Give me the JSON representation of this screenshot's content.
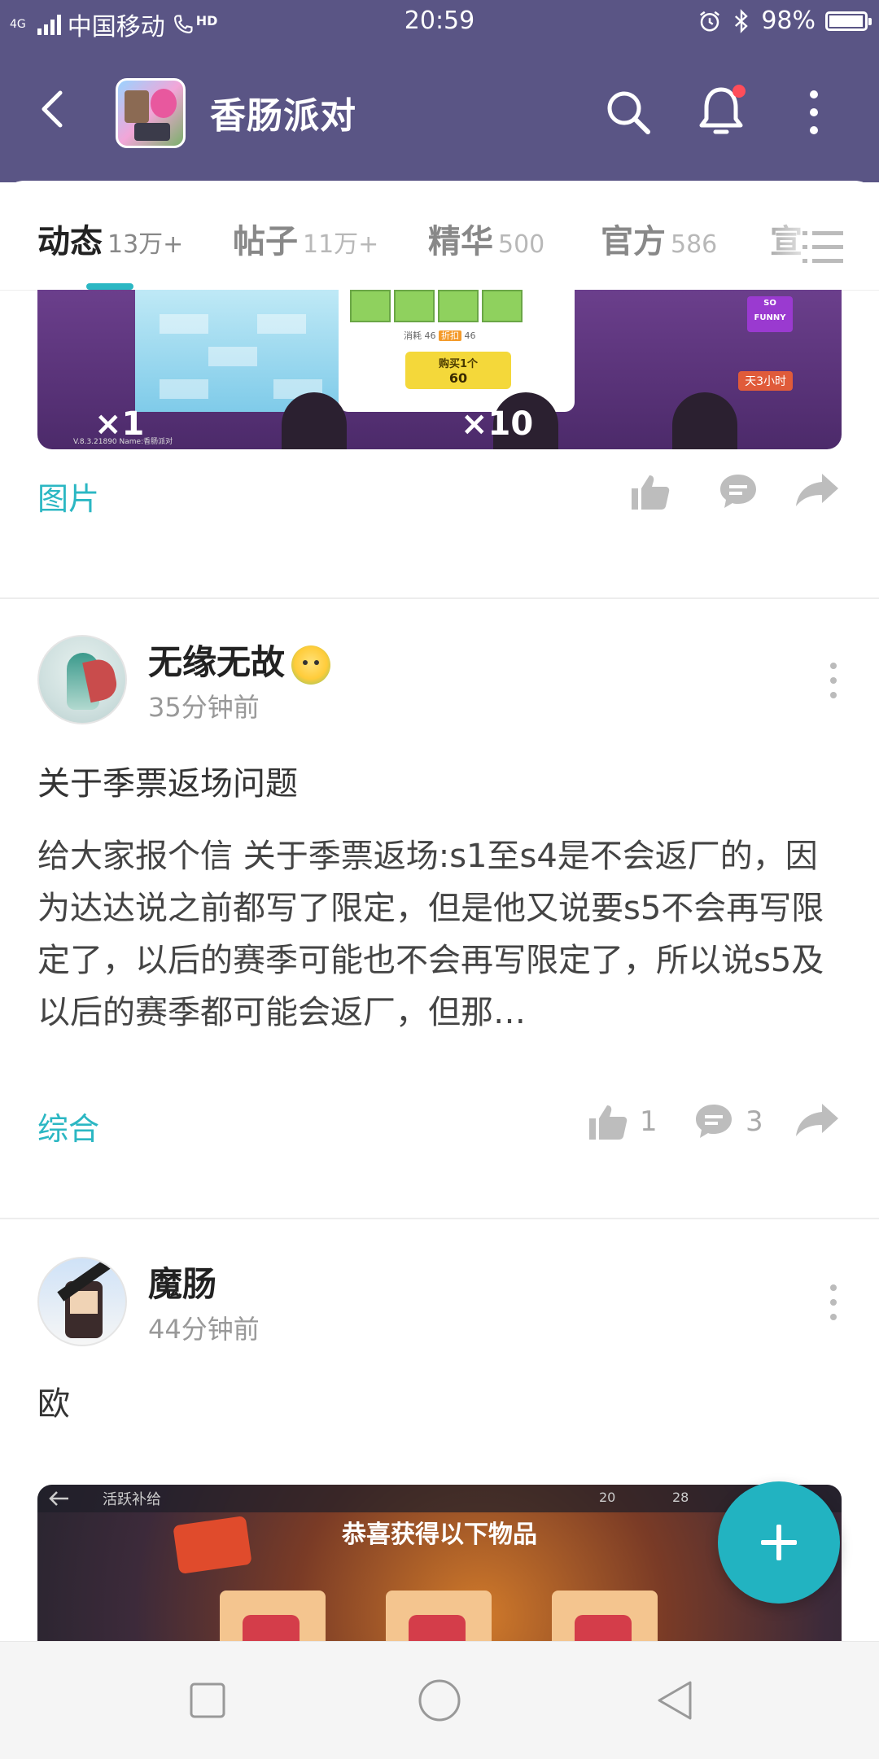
{
  "status_bar": {
    "network": "4G",
    "carrier": "中国移动",
    "hd": "HD",
    "time": "20:59",
    "battery_percent": "98%",
    "battery_level": 0.98
  },
  "header": {
    "title": "香肠派对",
    "icons": [
      "back-arrow-icon",
      "search-icon",
      "bell-icon",
      "more-vertical-icon"
    ],
    "has_notification_dot": true
  },
  "tabs": [
    {
      "label": "动态",
      "count": "13万+",
      "active": true
    },
    {
      "label": "帖子",
      "count": "11万+",
      "active": false
    },
    {
      "label": "精华",
      "count": "500",
      "active": false
    },
    {
      "label": "官方",
      "count": "586",
      "active": false
    },
    {
      "label": "宣",
      "count": "",
      "active": false
    }
  ],
  "feed": {
    "top_item": {
      "category": "图片",
      "image_text": {
        "cost_label": "消耗",
        "cost_a": "46",
        "cost_b": "46",
        "discount_badge": "折扣",
        "buy_label": "购买1个",
        "buy_price": "60",
        "multiplier_left": "×1",
        "multiplier_right": "×10",
        "version_text": "V.8.3.21890 Name:香肠派对",
        "timer_text": "天3小时",
        "corner_text": "SO FUNNY"
      }
    },
    "posts": [
      {
        "username": "无缘无故",
        "time": "35分钟前",
        "title": "关于季票返场问题",
        "body": "给大家报个信 关于季票返场:s1至s4是不会返厂的，因为达达说之前都写了限定，但是他又说要s5不会再写限定了，以后的赛季可能也不会再写限定了，所以说s5及以后的赛季都可能会返厂，但那…",
        "category": "综合",
        "likes": "1",
        "comments": "3"
      },
      {
        "username": "魔肠",
        "time": "44分钟前",
        "title": "欧",
        "image_text": {
          "topbar_label": "活跃补给",
          "headline": "恭喜获得以下物品",
          "count_a": "20",
          "count_b": "28"
        }
      }
    ]
  },
  "fab": {
    "icon": "plus-icon"
  },
  "nav_bar": {
    "icons": [
      "recent-apps-icon",
      "home-icon",
      "back-triangle-icon"
    ]
  },
  "colors": {
    "header_bg": "#5a5585",
    "accent": "#2bb7c3",
    "fab": "#22b3c1",
    "notification_dot": "#ff4d5a"
  }
}
